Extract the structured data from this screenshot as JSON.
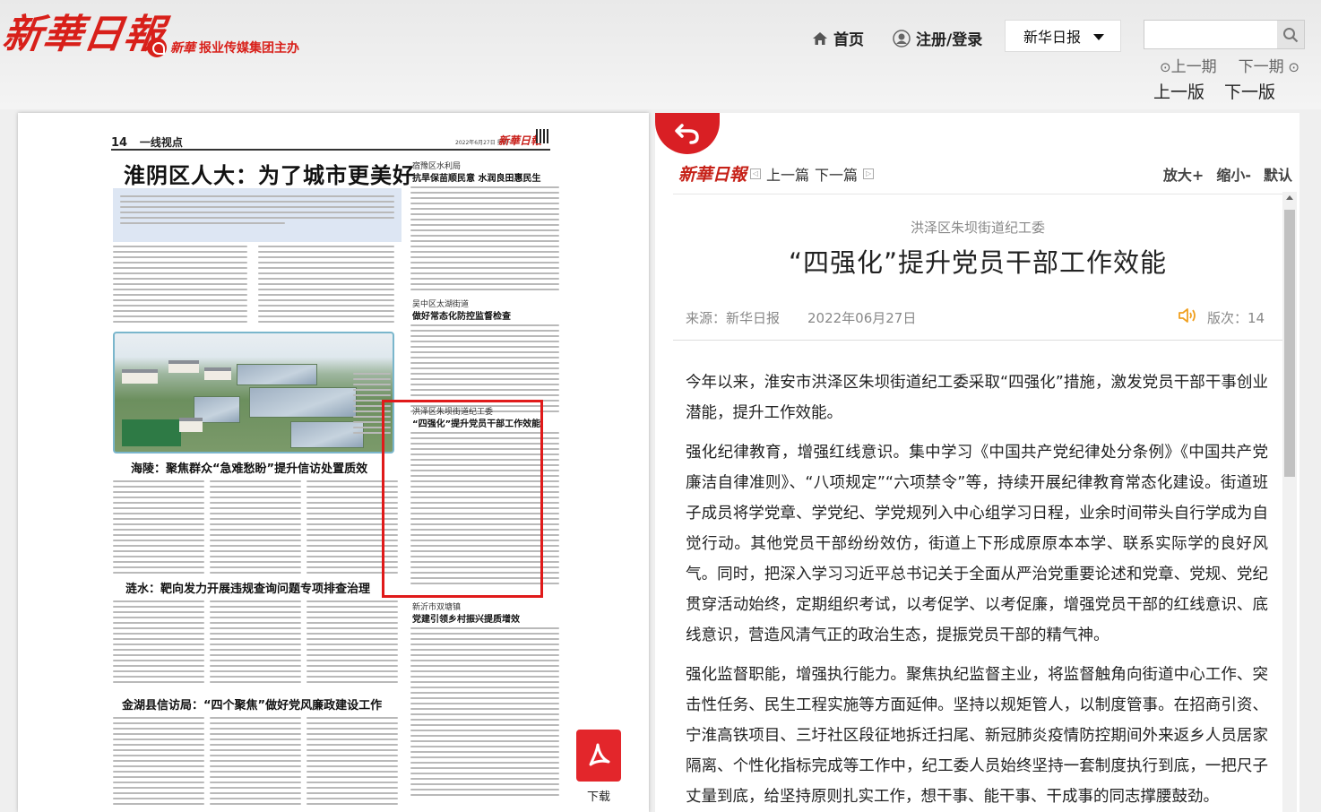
{
  "header": {
    "logo_text": "新華日報",
    "sub_logo_script": "新華",
    "sub_logo_text": "报业传媒集团主办",
    "home_label": "首页",
    "login_label": "注册/登录",
    "paper_select_value": "新华日报",
    "search_placeholder": "",
    "prev_period": "上一期",
    "next_period": "下一期",
    "prev_page": "上一版",
    "next_page": "下一版"
  },
  "newspaper": {
    "page_number": "14",
    "section": "一线视点",
    "date_line": "2022年6月27日 星期一",
    "mini_logo": "新華日報",
    "lead_headline": "淮阴区人大：为了城市更美好",
    "headline_2": "海陵：聚焦群众“急难愁盼”提升信访处置质效",
    "headline_3": "涟水：靶向发力开展违规查询问题专项排查治理",
    "headline_4": "金湖县信访局：“四个聚焦”做好党风廉政建设工作",
    "side1_kicker": "宿豫区水利局",
    "side1_title": "抗旱保苗顺民意 水润良田惠民生",
    "side2_kicker": "吴中区太湖街道",
    "side2_title": "做好常态化防控监督检查",
    "side3_kicker": "洪泽区朱坝街道纪工委",
    "side3_title": "“四强化”提升党员干部工作效能",
    "side4_kicker": "新沂市双塘镇",
    "side4_title": "党建引领乡村振兴提质增效",
    "download_label": "下载"
  },
  "article": {
    "logo_text": "新華日報",
    "prev_article": "上一篇",
    "next_article": "下一篇",
    "zoom_in": "放大+",
    "zoom_out": "缩小-",
    "default_size": "默认",
    "pretitle": "洪泽区朱坝街道纪工委",
    "title": "“四强化”提升党员干部工作效能",
    "source": "来源：新华日报",
    "date": "2022年06月27日",
    "page_label": "版次：14",
    "paragraphs": [
      "今年以来，淮安市洪泽区朱坝街道纪工委采取“四强化”措施，激发党员干部干事创业潜能，提升工作效能。",
      "强化纪律教育，增强红线意识。集中学习《中国共产党纪律处分条例》《中国共产党廉洁自律准则》、“八项规定”“六项禁令”等，持续开展纪律教育常态化建设。街道班子成员将学党章、学党纪、学党规列入中心组学习日程，业余时间带头自行学成为自觉行动。其他党员干部纷纷效仿，街道上下形成原原本本学、联系实际学的良好风气。同时，把深入学习习近平总书记关于全面从严治党重要论述和党章、党规、党纪贯穿活动始终，定期组织考试，以考促学、以考促廉，增强党员干部的红线意识、底线意识，营造风清气正的政治生态，提振党员干部的精气神。",
      "强化监督职能，增强执行能力。聚焦执纪监督主业，将监督触角向街道中心工作、突击性任务、民生工程实施等方面延伸。坚持以规矩管人，以制度管事。在招商引资、宁淮高铁项目、三圩社区段征地拆迁扫尾、新冠肺炎疫情防控期间外来返乡人员居家隔离、个性化指标完成等工作中，纪工委人员始终坚持一套制度执行到底，一把尺子丈量到底，给坚持原则扎实工作，想干事、能干事、干成事的同志撑腰鼓劲。"
    ]
  },
  "colors": {
    "brand_red": "#d8201a",
    "highlight_red": "#e01a1a",
    "pdf_red": "#e3262b",
    "speaker_orange": "#f0a020"
  },
  "icons": {
    "home": "home-icon",
    "user": "user-icon",
    "search": "search-icon",
    "back": "back-arrow-icon",
    "speaker": "speaker-icon",
    "pdf": "pdf-icon"
  }
}
